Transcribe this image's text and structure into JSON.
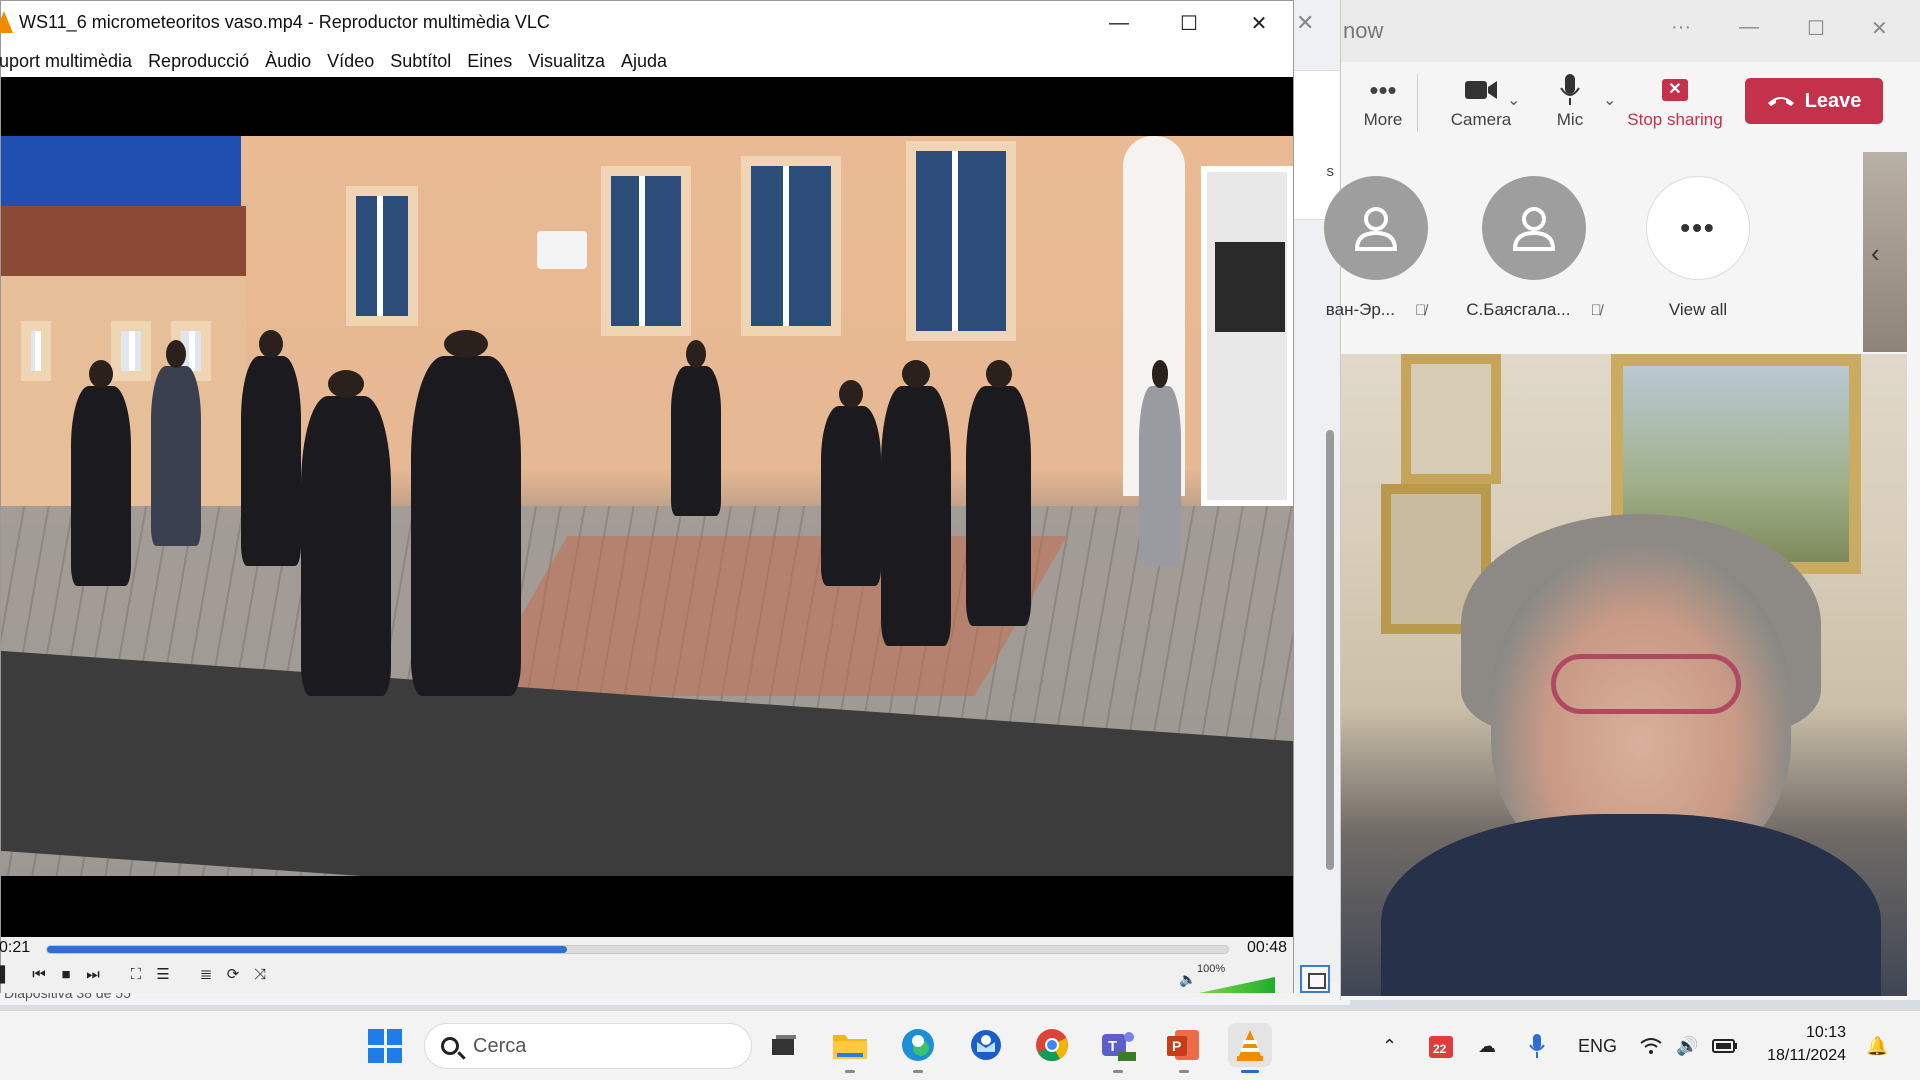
{
  "background_app": {
    "panel_fragment": "s",
    "status_text": "Diapositiva 38 de 55"
  },
  "teams": {
    "title_fragment": "now",
    "toolbar": {
      "more_label": "More",
      "camera_label": "Camera",
      "mic_label": "Mic",
      "stop_sharing_label": "Stop sharing",
      "leave_label": "Leave"
    },
    "participants": [
      {
        "name": "ван-Эр...",
        "muted": true
      },
      {
        "name": "С.Баясгала...",
        "muted": true
      }
    ],
    "view_all_label": "View all"
  },
  "vlc": {
    "title": "WS11_6 micrometeoritos vaso.mp4 - Reproductor multimèdia VLC",
    "menu": [
      "uport multimèdia",
      "Reproducció",
      "Àudio",
      "Vídeo",
      "Subtítol",
      "Eines",
      "Visualitza",
      "Ajuda"
    ],
    "time_current": "0:21",
    "time_total": "00:48",
    "progress": 0.44,
    "volume_label": "100%",
    "volume": 1.0
  },
  "taskbar": {
    "search_placeholder": "Cerca",
    "apps": [
      "task-view",
      "file-explorer",
      "edge",
      "outlook",
      "chrome",
      "teams-new",
      "powerpoint",
      "vlc"
    ],
    "calendar_badge": "22",
    "language": "ENG",
    "time": "10:13",
    "date": "18/11/2024"
  }
}
